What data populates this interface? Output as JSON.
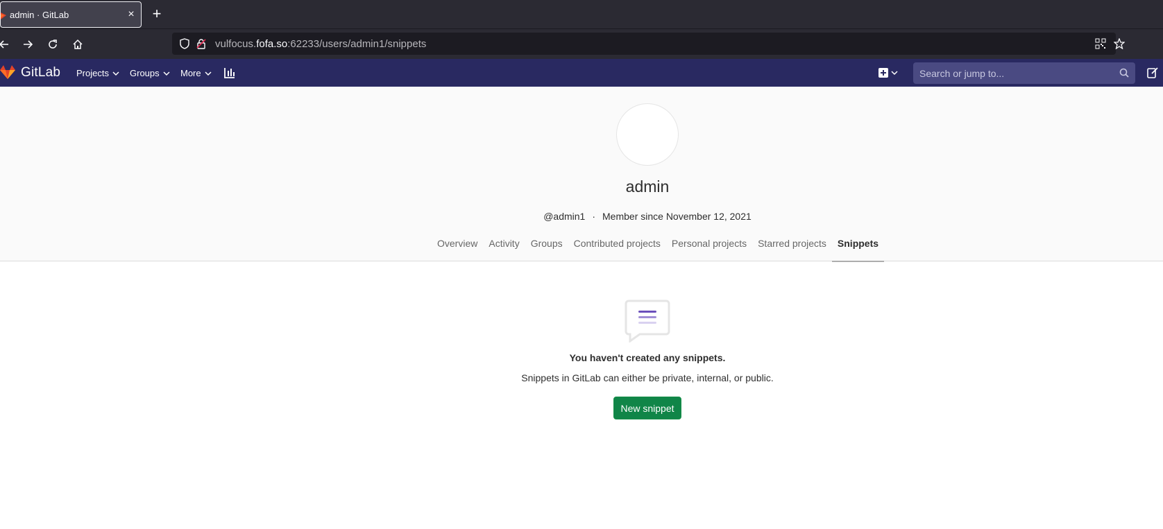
{
  "browser": {
    "tab_title": "admin · GitLab",
    "tab_close": "×",
    "new_tab": "+",
    "url_prefix": "vulfocus.",
    "url_host": "fofa.so",
    "url_rest": ":62233/users/admin1/snippets"
  },
  "header": {
    "brand": "GitLab",
    "nav": {
      "projects": "Projects",
      "groups": "Groups",
      "more": "More"
    },
    "search_placeholder": "Search or jump to..."
  },
  "profile": {
    "name": "admin",
    "username": "@admin1",
    "separator": "·",
    "member_since": "Member since November 12, 2021",
    "tabs": {
      "overview": "Overview",
      "activity": "Activity",
      "groups": "Groups",
      "contributed": "Contributed projects",
      "personal": "Personal projects",
      "starred": "Starred projects",
      "snippets": "Snippets"
    }
  },
  "empty_state": {
    "title": "You haven't created any snippets.",
    "description": "Snippets in GitLab can either be private, internal, or public.",
    "button": "New snippet"
  },
  "colors": {
    "gitlab_header": "#292961",
    "primary_button": "#108548",
    "browser_chrome": "#2b2a33"
  }
}
